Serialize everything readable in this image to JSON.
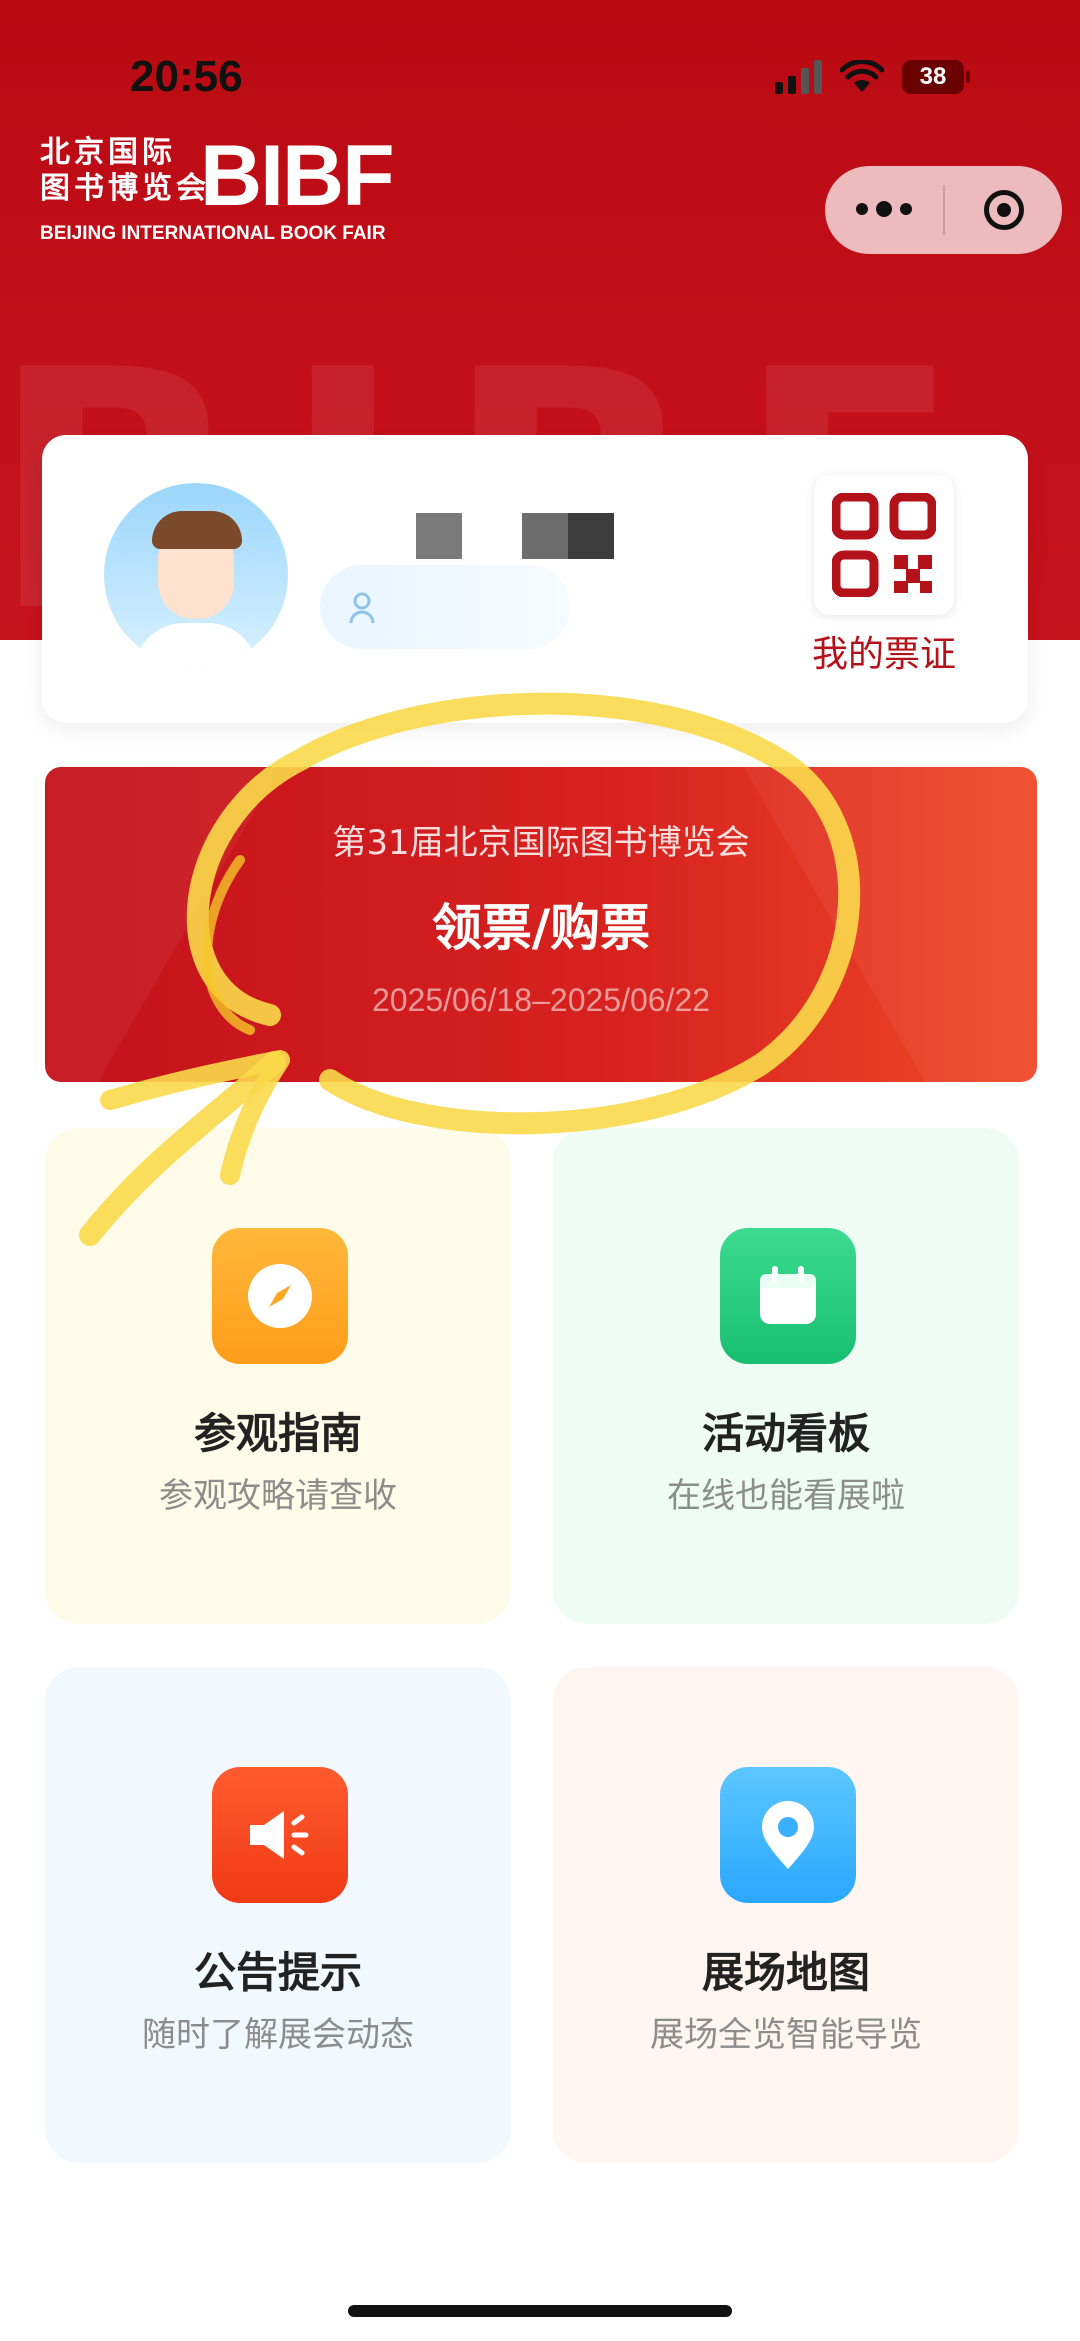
{
  "status_bar": {
    "time": "20:56",
    "battery": "38"
  },
  "logo": {
    "cn_line1": "北京国际",
    "cn_line2": "图书博览会",
    "mark": "BIBF",
    "en": "BEIJING INTERNATIONAL BOOK FAIR"
  },
  "capsule": {
    "more_icon": "more-dots-icon",
    "close_icon": "target-close-icon"
  },
  "profile": {
    "qr_label": "我的票证"
  },
  "ticket": {
    "event": "第31届北京国际图书博览会",
    "action": "领票/购票",
    "dates": "2025/06/18–2025/06/22"
  },
  "tiles": [
    {
      "title": "参观指南",
      "subtitle": "参观攻略请查收",
      "icon": "compass-icon",
      "color": "#ffa726"
    },
    {
      "title": "活动看板",
      "subtitle": "在线也能看展啦",
      "icon": "calendar-icon",
      "color": "#20c677"
    },
    {
      "title": "公告提示",
      "subtitle": "随时了解展会动态",
      "icon": "megaphone-icon",
      "color": "#f5431c"
    },
    {
      "title": "展场地图",
      "subtitle": "展场全览智能导览",
      "icon": "map-pin-icon",
      "color": "#38afff"
    }
  ],
  "colors": {
    "brand_red": "#c3101a",
    "annotation_yellow": "#f9d94a"
  }
}
